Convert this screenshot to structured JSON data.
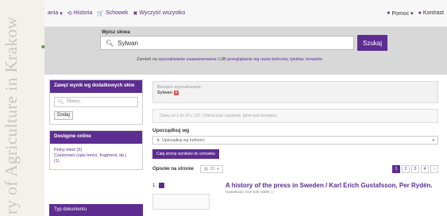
{
  "watermark": {
    "text": "ry of Agriculture in Krakow"
  },
  "topbar": {
    "items": [
      {
        "icon": "▾",
        "label": "ania"
      },
      {
        "icon": "⟲",
        "label": "Historia"
      },
      {
        "icon": "🛒",
        "label": "Schowek"
      },
      {
        "icon": "✖",
        "label": "Wyczyść wszystko"
      }
    ],
    "right": [
      {
        "icon": "●",
        "label": "Pomoc ▾"
      },
      {
        "icon": "●",
        "label": "Kontrast"
      }
    ]
  },
  "search": {
    "label": "Wpisz słowa",
    "value": "Sylwan",
    "button": "Szukaj",
    "links_prefix": "Zamień na",
    "link_advanced": "wyszukiwanie zaawansowane",
    "links_or": "LUB",
    "link_browse": "przeglądanie wg nazw twórców, tytułów, tematów"
  },
  "sidebar": {
    "narrow_title": "Zawęź wynik wg dodatkowych słów",
    "narrow_placeholder": "Słowo...",
    "add_button": "Dodaj",
    "online_title": "Dostępne online",
    "online_items": [
      "Pełny tekst (5)",
      "Częściowo (spis treści, fragment, itp.)",
      "(1)"
    ],
    "doctype_title": "Typ dokumentu"
  },
  "main": {
    "current_label": "Bieżące wyszukiwanie:",
    "current_term": "Sylwan",
    "info_text": "Opisy od 1 do 20 z 127 ( Kliknij tytuł i sprawdź, gdzie jest dostępny.",
    "sort_label": "Uporządkuj wg",
    "sort_value": "Uporządkuj wg trafności",
    "save_button": "Całą stronę wyników do schowka",
    "per_page_label": "Opisów na stronie",
    "per_page_value": "20",
    "pages": [
      "1",
      "2",
      "3",
      "4",
      "›"
    ]
  },
  "result": {
    "number": "1.",
    "title": "A history of the press in Sweden / Karl Erich Gustafsson, Per Rydén.",
    "author": "Gustafsson, Karl Erik (1938- )."
  },
  "colors": {
    "accent": "#5d2d91",
    "arrow": "#4a9a3a"
  }
}
